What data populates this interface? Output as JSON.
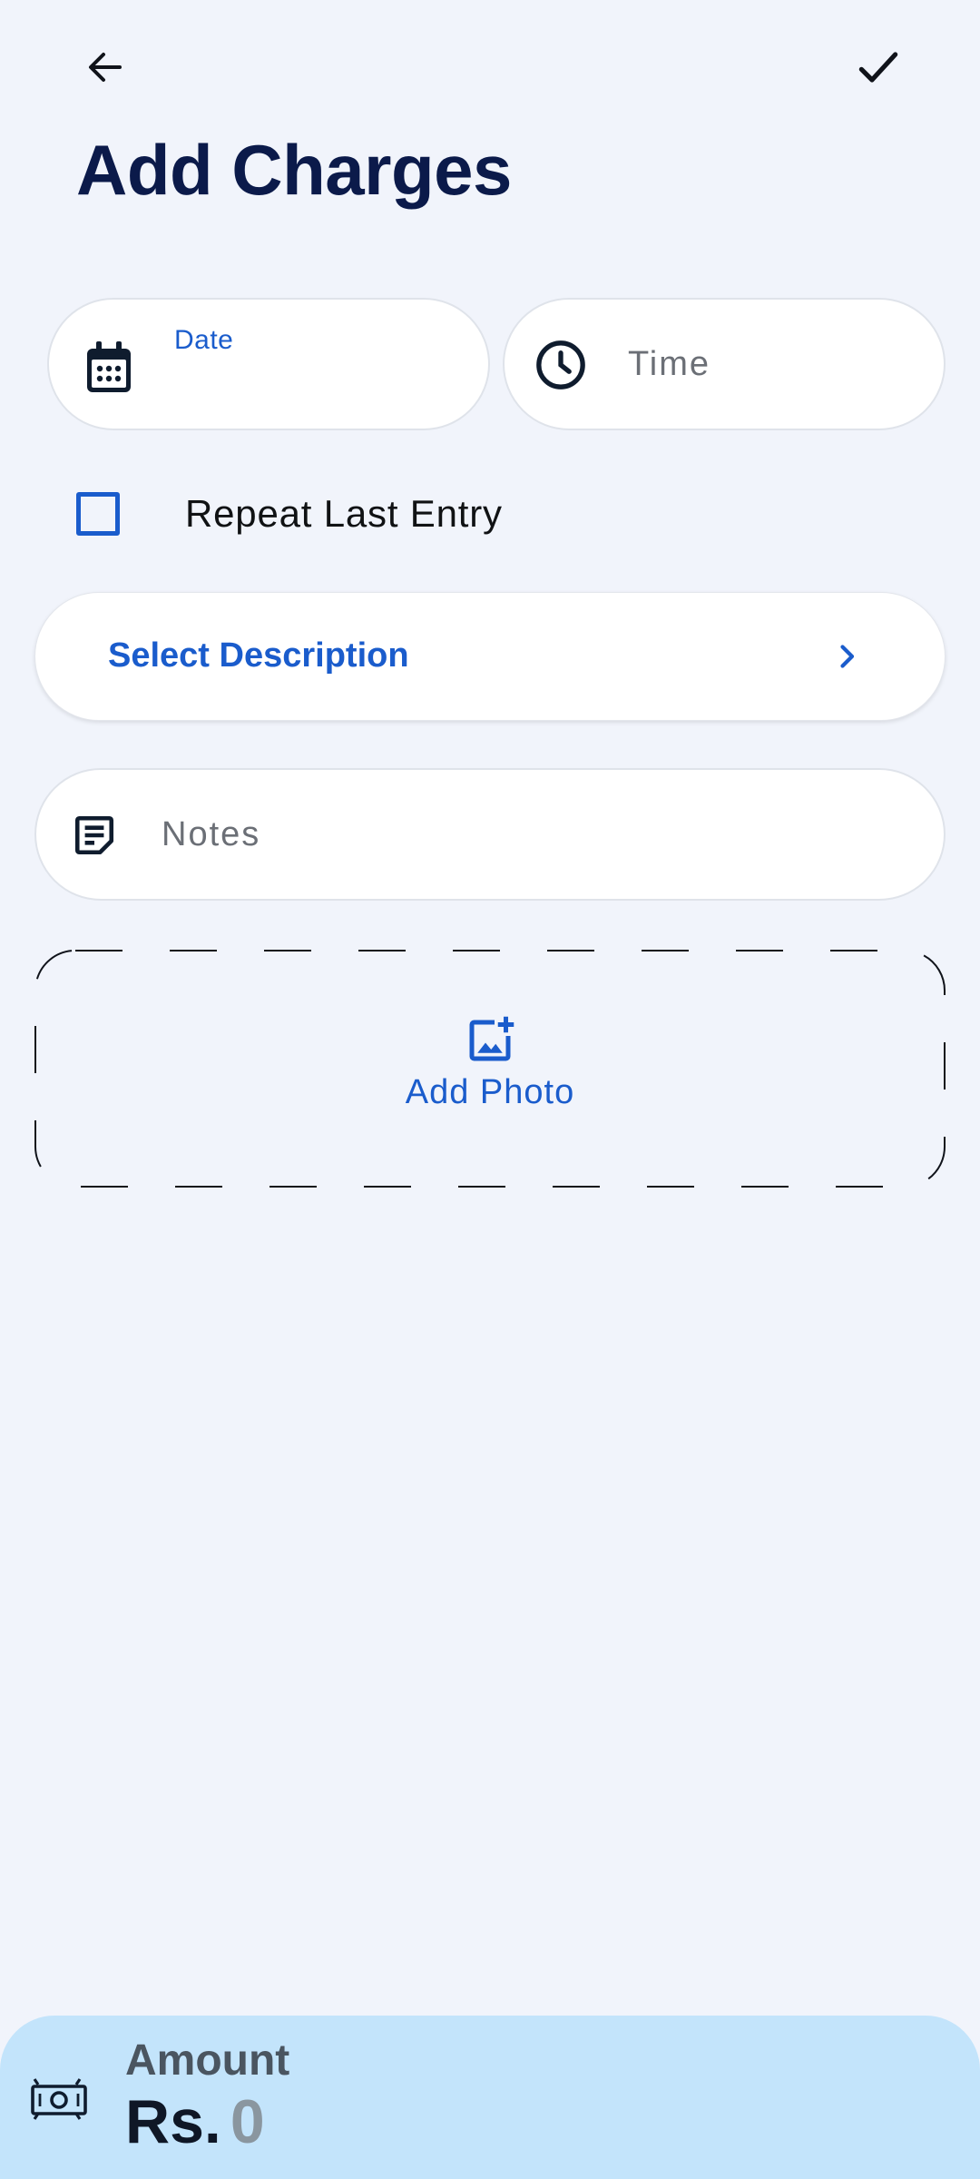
{
  "page": {
    "title": "Add Charges"
  },
  "fields": {
    "date_label": "Date",
    "time_placeholder": "Time",
    "repeat_label": "Repeat Last Entry",
    "repeat_checked": false,
    "description_label": "Select Description",
    "notes_placeholder": "Notes",
    "add_photo_label": "Add Photo"
  },
  "amount": {
    "label": "Amount",
    "currency": "Rs.",
    "value": "0"
  },
  "colors": {
    "background": "#f1f4fb",
    "accent": "#1a5ccc",
    "title": "#0b1a4a",
    "amount_bar": "#c3e4fb"
  },
  "icons": {
    "back": "arrow-left-icon",
    "confirm": "check-icon",
    "date": "calendar-icon",
    "time": "clock-icon",
    "description": "chevron-right-icon",
    "notes": "note-icon",
    "photo": "add-photo-icon",
    "amount": "money-icon"
  }
}
